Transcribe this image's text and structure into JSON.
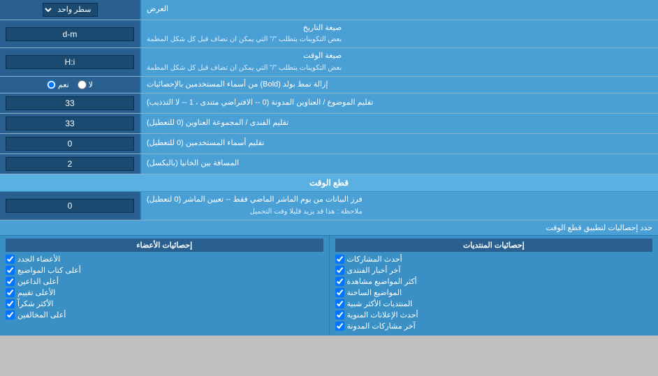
{
  "title": "العرض",
  "rows": [
    {
      "id": "single-line",
      "label": "سطر واحد",
      "type": "dropdown",
      "value": "سطر واحد"
    },
    {
      "id": "date-format",
      "label": "صيغة التاريخ",
      "sublabel": "بعض التكوينات يتطلب \"/\" التي يمكن ان تضاف قبل كل شكل المطمة",
      "type": "input",
      "value": "d-m"
    },
    {
      "id": "time-format",
      "label": "صيغة الوقت",
      "sublabel": "بعض التكوينات يتطلب \"/\" التي يمكن ان تضاف قبل كل شكل المطمة",
      "type": "input",
      "value": "H:i"
    },
    {
      "id": "bold-remove",
      "label": "إزالة نمط بولد (Bold) من أسماء المستخدمين بالإحصائيات",
      "type": "radio",
      "options": [
        "نعم",
        "لا"
      ],
      "selected": "نعم"
    },
    {
      "id": "forum-topics",
      "label": "تقليم الموضوع / العناوين المدونة (0 -- الافتراضي متندى ، 1 -- لا التذذيب)",
      "type": "input",
      "value": "33"
    },
    {
      "id": "forum-group",
      "label": "تقليم الفندى / المجموعة العناوين (0 للتعطيل)",
      "type": "input",
      "value": "33"
    },
    {
      "id": "user-names",
      "label": "تقليم أسماء المستخدمين (0 للتعطيل)",
      "type": "input",
      "value": "0"
    },
    {
      "id": "spacing",
      "label": "المسافة بين الخانيا (بالبكسل)",
      "type": "input",
      "value": "2"
    }
  ],
  "section_realtime": {
    "title": "قطع الوقت",
    "row": {
      "label": "فرز البيانات من يوم الماشر الماضي فقط -- تعيين الماشر (0 لتعطيل)",
      "note": "ملاحظة : هذا قد يزيد قليلا وقت التحميل",
      "value": "0"
    },
    "limit_label": "حدد إحصاليات لتطبيق قطع الوقت",
    "cols": [
      {
        "title": null,
        "items": [
          "أحدث المشاركات",
          "آخر أخبار الفنتدى",
          "أكثر المواضيع مشاهدة",
          "المواضيع الساخنة",
          "المنتديات الأكثر شبية",
          "أحدث الإعلانات المنوية",
          "آخر مشاركات المدونة"
        ]
      },
      {
        "title": "إحصائيات الأعضاء",
        "items": [
          "الأعضاء الجدد",
          "أعلى كتاب المواضيع",
          "أعلى الداعين",
          "الأعلى تقييم",
          "الأكثر شكراً",
          "أعلى المخالفين"
        ]
      }
    ]
  },
  "checkboxes_col1_title": "إحصائيات المنتديات",
  "checkboxes_col2_title": "إحصائيات الأعضاء",
  "col1_items": [
    "أحدث المشاركات",
    "آخر أخبار الفنتدى",
    "أكثر المواضيع مشاهدة",
    "المواضيع الساخنة",
    "المنتديات الأكثر شبية",
    "أحدث الإعلانات المنوية",
    "آخر مشاركات المدونة"
  ],
  "col2_items": [
    "الأعضاء الجدد",
    "أعلى كتاب المواضيع",
    "أعلى الداعين",
    "الأعلى تقييم",
    "الأكثر شكراً",
    "أعلى المخالفين"
  ],
  "limit_stats_label": "حدد إحصاليات لتطبيق قطع الوقت",
  "title_label": "العرض"
}
